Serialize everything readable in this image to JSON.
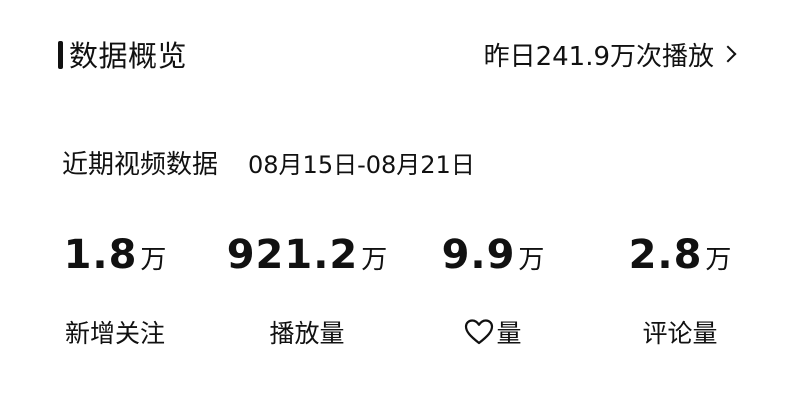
{
  "header": {
    "title": "数据概览",
    "yesterday_link": "昨日241.9万次播放"
  },
  "period": {
    "label": "近期视频数据",
    "range": "08月15日-08月21日"
  },
  "stats": [
    {
      "value": "1.8",
      "unit": "万",
      "label": "新增关注"
    },
    {
      "value": "921.2",
      "unit": "万",
      "label": "播放量"
    },
    {
      "value": "9.9",
      "unit": "万",
      "label": "量",
      "icon": "heart-icon"
    },
    {
      "value": "2.8",
      "unit": "万",
      "label": "评论量"
    }
  ]
}
